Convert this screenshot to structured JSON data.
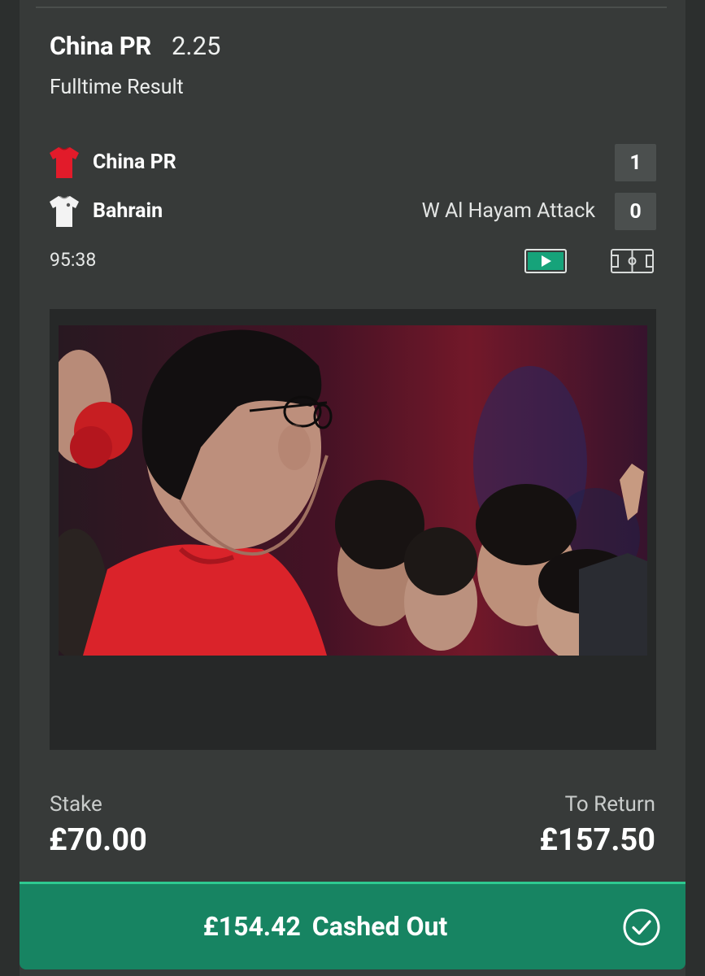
{
  "selection": {
    "name": "China PR",
    "odds": "2.25",
    "market": "Fulltime Result"
  },
  "match": {
    "home": {
      "name": "China PR",
      "score": "1",
      "shirt_color": "#e21b2a",
      "shirt_icon": "red-shirt-icon"
    },
    "away": {
      "name": "Bahrain",
      "score": "0",
      "shirt_color": "#f3f3f3",
      "shirt_icon": "white-shirt-icon",
      "incident": "W Al Hayam Attack"
    },
    "clock": "95:38"
  },
  "controls": {
    "play_icon": "play-video-icon",
    "pitch_icon": "pitch-tracker-icon"
  },
  "bet": {
    "stake_label": "Stake",
    "stake_value": "£70.00",
    "return_label": "To Return",
    "return_value": "£157.50"
  },
  "cashout": {
    "amount": "£154.42",
    "label": "Cashed Out",
    "icon": "checkmark-circle-icon"
  },
  "colors": {
    "background": "#2c2f2e",
    "card": "#373a39",
    "accent_green": "#178462",
    "accent_green_border": "#2ec990",
    "play_green": "#16a37a"
  }
}
